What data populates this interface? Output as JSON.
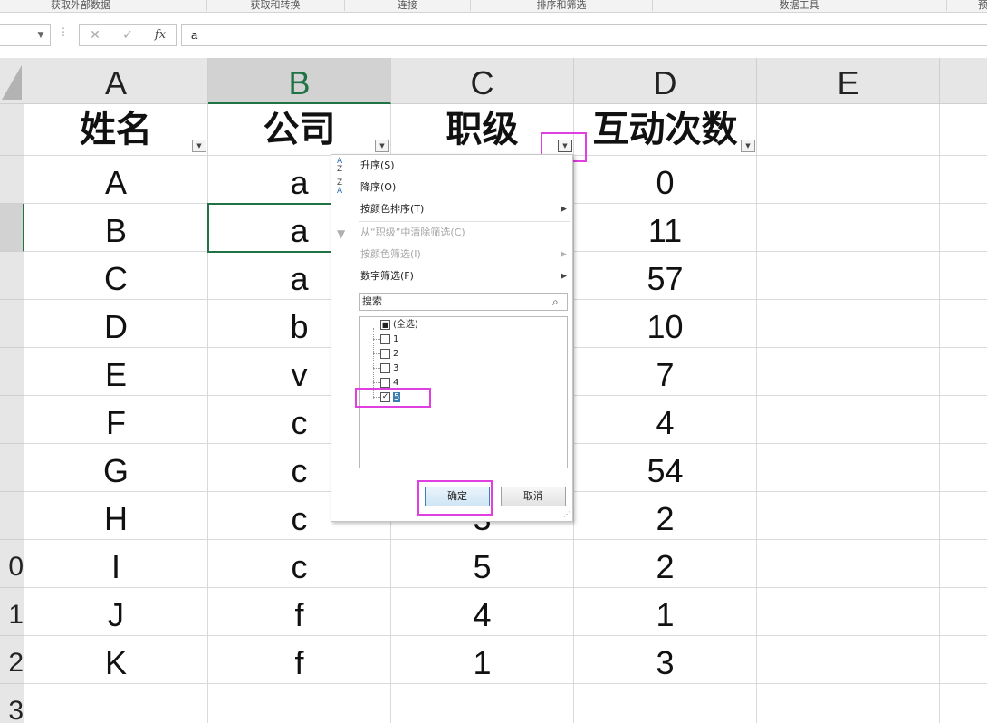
{
  "ribbon": {
    "groups": [
      "获取外部数据",
      "获取和转换",
      "连接",
      "排序和筛选",
      "数据工具",
      "预"
    ]
  },
  "formula_bar": {
    "name_box": "",
    "cancel_icon": "✕",
    "enter_icon": "✓",
    "fx_label": "fx",
    "formula": "a"
  },
  "grid": {
    "columns": [
      "A",
      "B",
      "C",
      "D",
      "E"
    ],
    "selected_column": "B",
    "row_numbers": [
      "",
      "",
      "",
      "",
      "",
      "",
      "",
      "",
      "",
      "0",
      "1",
      "2",
      "3"
    ],
    "header_row": [
      "姓名",
      "公司",
      "职级",
      "互动次数",
      ""
    ],
    "rows": [
      [
        "A",
        "a",
        "",
        "0",
        ""
      ],
      [
        "B",
        "a",
        "",
        "11",
        ""
      ],
      [
        "C",
        "a",
        "",
        "57",
        ""
      ],
      [
        "D",
        "b",
        "",
        "10",
        ""
      ],
      [
        "E",
        "v",
        "",
        "7",
        ""
      ],
      [
        "F",
        "c",
        "",
        "4",
        ""
      ],
      [
        "G",
        "c",
        "",
        "54",
        ""
      ],
      [
        "H",
        "c",
        "3",
        "2",
        ""
      ],
      [
        "I",
        "c",
        "5",
        "2",
        ""
      ],
      [
        "J",
        "f",
        "4",
        "1",
        ""
      ],
      [
        "K",
        "f",
        "1",
        "3",
        ""
      ]
    ],
    "dropdown_icon": "▼"
  },
  "filter_menu": {
    "items": {
      "sort_asc": "升序(S)",
      "sort_desc": "降序(O)",
      "sort_by_color": "按颜色排序(T)",
      "clear_filter": "从“职级”中清除筛选(C)",
      "filter_by_color": "按颜色筛选(I)",
      "number_filter": "数字筛选(F)"
    },
    "search_placeholder": "搜索",
    "values": [
      {
        "label": "(全选)",
        "state": "mixed"
      },
      {
        "label": "1",
        "state": "unchecked"
      },
      {
        "label": "2",
        "state": "unchecked"
      },
      {
        "label": "3",
        "state": "unchecked"
      },
      {
        "label": "4",
        "state": "unchecked"
      },
      {
        "label": "5",
        "state": "checked"
      }
    ],
    "ok_label": "确定",
    "cancel_label": "取消"
  },
  "colors": {
    "highlight": "#e040e0",
    "excel_green": "#217346"
  }
}
